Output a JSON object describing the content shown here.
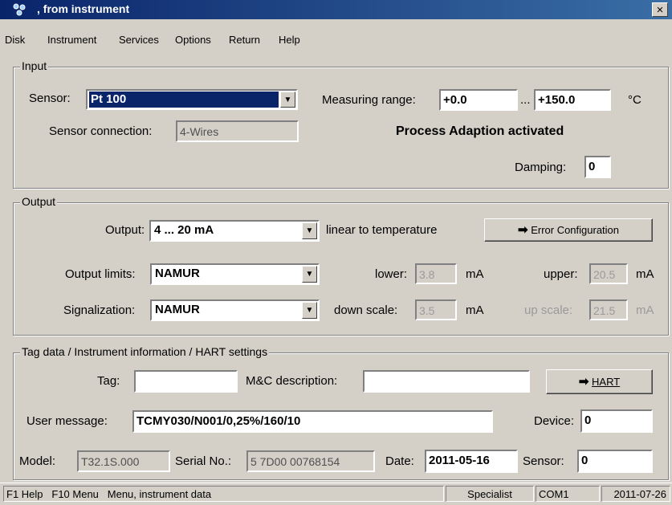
{
  "window": {
    "title": ", from instrument",
    "close_glyph": "×"
  },
  "menu": [
    "Disk",
    "Instrument",
    "Services",
    "Options",
    "Return",
    "Help"
  ],
  "input": {
    "group_label": "Input",
    "sensor_label": "Sensor:",
    "sensor_value": "Pt 100",
    "measuring_range_label": "Measuring range:",
    "range_min": "+0.0",
    "range_sep": "...",
    "range_max": "+150.0",
    "range_unit": "°C",
    "sensor_connection_label": "Sensor connection:",
    "sensor_connection_value": "4-Wires",
    "process_adaption": "Process Adaption activated",
    "damping_label": "Damping:",
    "damping_value": "0"
  },
  "output": {
    "group_label": "Output",
    "output_label": "Output:",
    "output_value": "4 ... 20 mA",
    "linear_text": "linear to temperature",
    "error_config_button": "Error Configuration",
    "limits_label": "Output limits:",
    "limits_value": "NAMUR",
    "lower_label": "lower:",
    "lower_value": "3.8",
    "lower_unit": "mA",
    "upper_label": "upper:",
    "upper_value": "20.5",
    "upper_unit": "mA",
    "signal_label": "Signalization:",
    "signal_value": "NAMUR",
    "down_label": "down scale:",
    "down_value": "3.5",
    "down_unit": "mA",
    "up_label": "up scale:",
    "up_value": "21.5",
    "up_unit": "mA"
  },
  "tag": {
    "group_label": "Tag data / Instrument information / HART settings",
    "tag_label": "Tag:",
    "tag_value": "",
    "mc_label": "M&C description:",
    "mc_value": "",
    "hart_button": "HART",
    "user_msg_label": "User message:",
    "user_msg_value": "TCMY030/N001/0,25%/160/10",
    "device_label": "Device:",
    "device_value": "0",
    "model_label": "Model:",
    "model_value": "T32.1S.000",
    "serial_label": "Serial No.:",
    "serial_value": "5 7D00 00768154",
    "date_label": "Date:",
    "date_value": "2011-05-16",
    "sensor_label": "Sensor:",
    "sensor_value": "0"
  },
  "status": {
    "f1": "F1 Help",
    "f10": "F10 Menu",
    "message": "Menu, instrument data",
    "role": "Specialist",
    "port": "COM1",
    "date": "2011-07-26"
  },
  "icons": {
    "app": "instrument-icon",
    "arrow": "arrow-right-icon"
  }
}
